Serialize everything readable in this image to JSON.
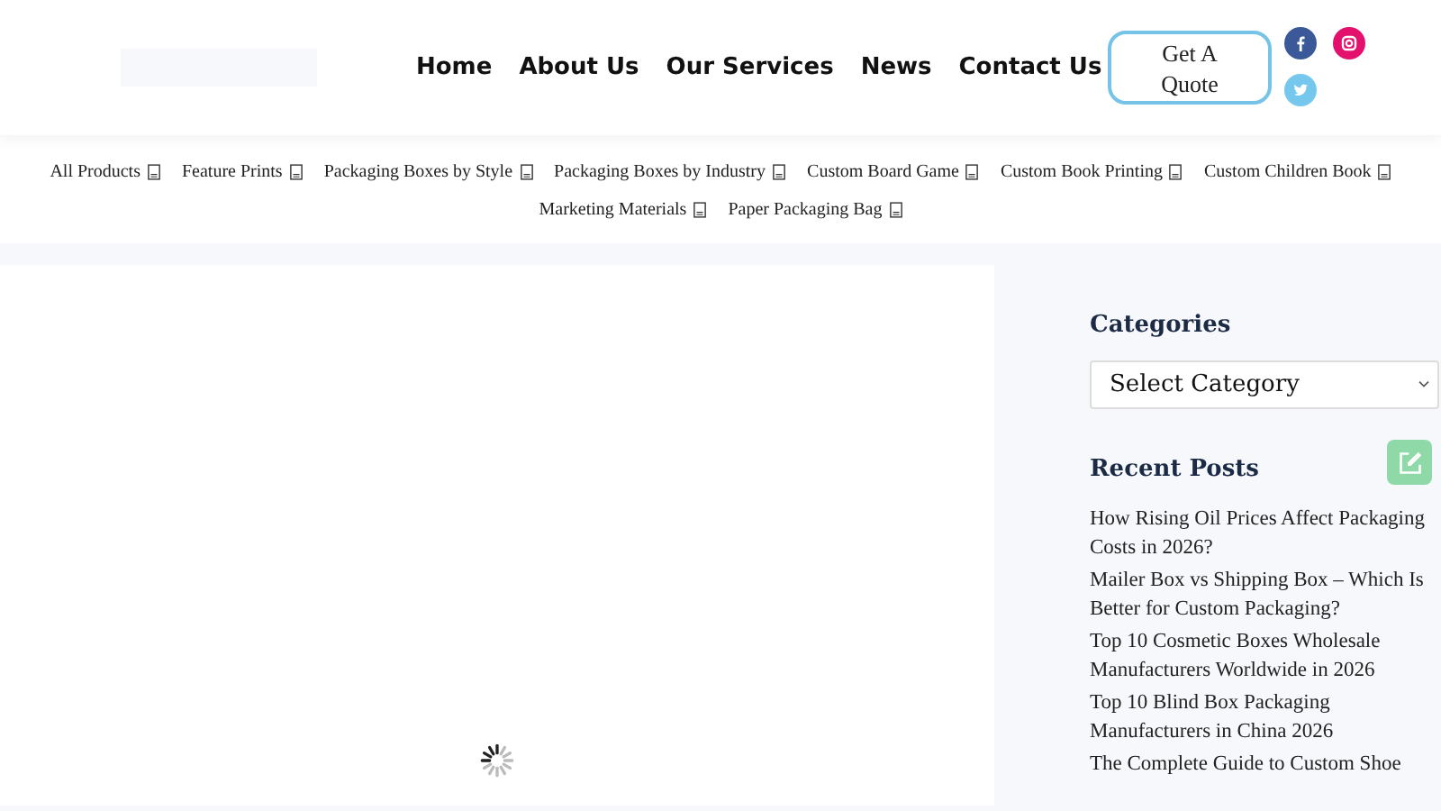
{
  "header": {
    "nav": [
      "Home",
      "About Us",
      "Our Services",
      "News",
      "Contact Us"
    ],
    "quote_button": "Get A Quote"
  },
  "categories": [
    "All Products",
    "Feature Prints",
    "Packaging Boxes by Style",
    "Packaging Boxes by Industry",
    "Custom Board Game",
    "Custom Book Printing",
    "Custom Children Book",
    "Marketing Materials",
    "Paper Packaging Bag"
  ],
  "sidebar": {
    "categories_title": "Categories",
    "category_select": "Select Category",
    "recent_title": "Recent Posts",
    "posts": [
      "How Rising Oil Prices Affect Packaging Costs in 2026?",
      "Mailer Box vs Shipping Box – Which Is Better for Custom Packaging?",
      "Top 10 Cosmetic Boxes Wholesale Manufacturers Worldwide in 2026",
      "Top 10 Blind Box Packaging Manufacturers in China 2026",
      "The Complete Guide to Custom Shoe"
    ]
  }
}
